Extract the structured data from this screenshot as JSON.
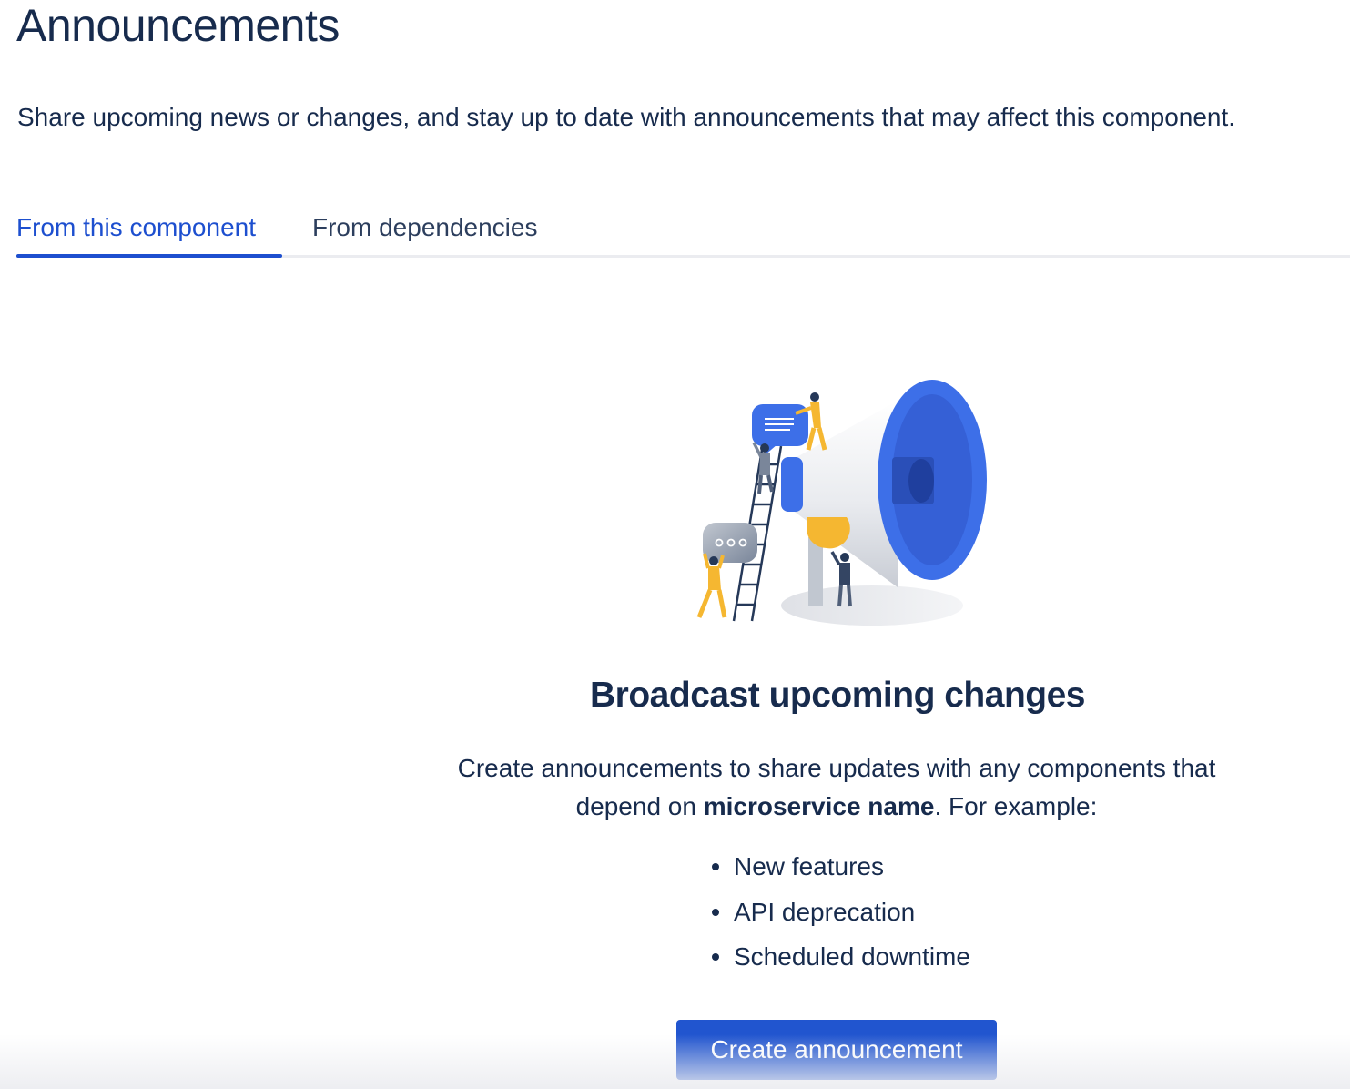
{
  "page": {
    "title": "Announcements",
    "description": "Share upcoming news or changes, and stay up to date with announcements that may affect this component."
  },
  "tabs": [
    {
      "label": "From this component",
      "selected": true
    },
    {
      "label": "From dependencies",
      "selected": false
    }
  ],
  "empty_state": {
    "illustration": "megaphone-illustration",
    "heading": "Broadcast upcoming changes",
    "text_before": "Create announcements to share updates with any components that depend on ",
    "text_bold": "microservice name",
    "text_after": ". For example:",
    "examples": [
      "New features",
      "API deprecation",
      "Scheduled downtime"
    ],
    "button_label": "Create announcement"
  },
  "colors": {
    "text": "#172b4d",
    "accent": "#1d4fcf",
    "button": "#2155cf",
    "divider": "#ebecf0",
    "illustration_blue": "#3d6fe8",
    "illustration_yellow": "#f5b731",
    "illustration_grey": "#a5adba"
  }
}
